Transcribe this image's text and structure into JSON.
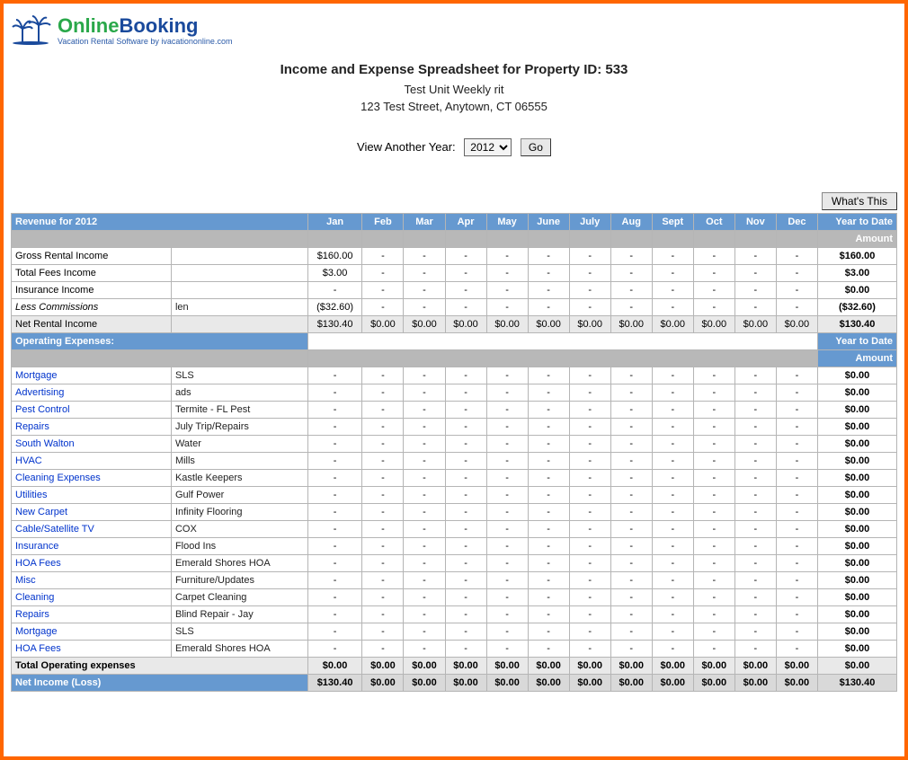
{
  "logo": {
    "part1": "Online",
    "part2": "Booking",
    "tagline": "Vacation Rental Software by ivacationonline.com"
  },
  "header": {
    "title": "Income and Expense Spreadsheet for Property ID: 533",
    "unit": "Test Unit Weekly rit",
    "address": "123 Test Street, Anytown, CT 06555"
  },
  "yearPicker": {
    "label": "View Another Year:",
    "selected": "2012",
    "go": "Go"
  },
  "whatsThis": "What's This",
  "months": [
    "Jan",
    "Feb",
    "Mar",
    "Apr",
    "May",
    "June",
    "July",
    "Aug",
    "Sept",
    "Oct",
    "Nov",
    "Dec"
  ],
  "revenueHeader": "Revenue for 2012",
  "ytdHeader": "Year to Date",
  "amountHeader": "Amount",
  "revenue": [
    {
      "label": "Gross Rental Income",
      "sub": "",
      "jan": "$160.00",
      "rest": "-",
      "ytd": "$160.00",
      "link": false,
      "italic": false
    },
    {
      "label": "Total Fees Income",
      "sub": "",
      "jan": "$3.00",
      "rest": "-",
      "ytd": "$3.00",
      "link": false,
      "italic": false
    },
    {
      "label": "Insurance Income",
      "sub": "",
      "jan": "-",
      "rest": "-",
      "ytd": "$0.00",
      "link": false,
      "italic": false
    },
    {
      "label": "Less Commissions",
      "sub": "len",
      "jan": "($32.60)",
      "rest": "-",
      "ytd": "($32.60)",
      "link": false,
      "italic": true
    }
  ],
  "netRental": {
    "label": "Net Rental Income",
    "jan": "$130.40",
    "rest": "$0.00",
    "ytd": "$130.40"
  },
  "opexHeader": "Operating Expenses:",
  "expenses": [
    {
      "label": "Mortgage",
      "sub": "SLS"
    },
    {
      "label": "Advertising",
      "sub": "ads"
    },
    {
      "label": "Pest Control",
      "sub": "Termite - FL Pest"
    },
    {
      "label": "Repairs",
      "sub": "July Trip/Repairs"
    },
    {
      "label": "South Walton",
      "sub": "Water"
    },
    {
      "label": "HVAC",
      "sub": "Mills"
    },
    {
      "label": "Cleaning Expenses",
      "sub": "Kastle Keepers"
    },
    {
      "label": "Utilities",
      "sub": "Gulf Power"
    },
    {
      "label": "New Carpet",
      "sub": "Infinity Flooring"
    },
    {
      "label": "Cable/Satellite TV",
      "sub": "COX"
    },
    {
      "label": "Insurance",
      "sub": "Flood Ins"
    },
    {
      "label": "HOA Fees",
      "sub": "Emerald Shores HOA"
    },
    {
      "label": "Misc",
      "sub": "Furniture/Updates"
    },
    {
      "label": "Cleaning",
      "sub": "Carpet Cleaning"
    },
    {
      "label": "Repairs",
      "sub": "Blind Repair - Jay"
    },
    {
      "label": "Mortgage",
      "sub": "SLS"
    },
    {
      "label": "HOA Fees",
      "sub": "Emerald Shores HOA"
    }
  ],
  "expenseCell": "-",
  "expenseYtd": "$0.00",
  "totalOpex": {
    "label": "Total Operating expenses",
    "val": "$0.00",
    "ytd": "$0.00"
  },
  "netIncome": {
    "label": "Net Income (Loss)",
    "jan": "$130.40",
    "rest": "$0.00",
    "ytd": "$130.40"
  }
}
